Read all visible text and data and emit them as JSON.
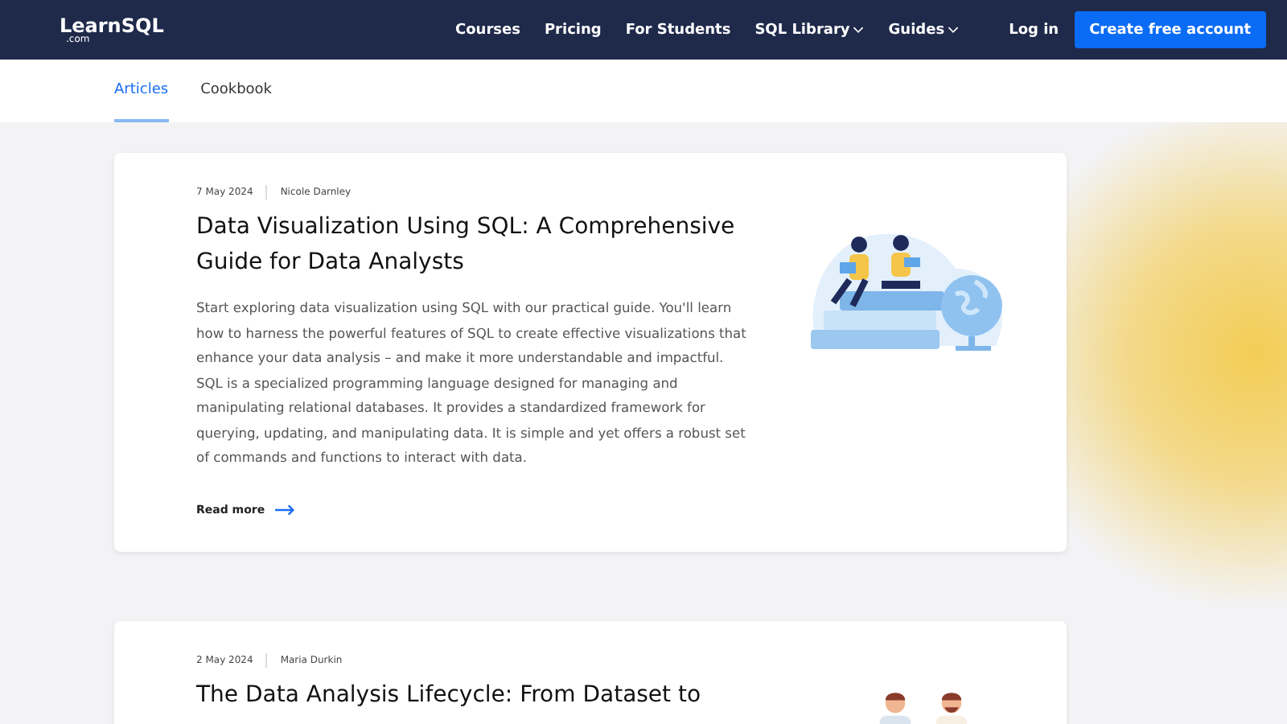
{
  "header": {
    "logo": {
      "name": "LearnSQL",
      "suffix": ".com"
    },
    "nav": [
      {
        "label": "Courses",
        "dropdown": false
      },
      {
        "label": "Pricing",
        "dropdown": false
      },
      {
        "label": "For Students",
        "dropdown": false
      },
      {
        "label": "SQL Library",
        "dropdown": true
      },
      {
        "label": "Guides",
        "dropdown": true
      }
    ],
    "login": "Log in",
    "cta": "Create free account"
  },
  "tabs": [
    {
      "label": "Articles",
      "selected": true
    },
    {
      "label": "Cookbook",
      "selected": false
    }
  ],
  "articles": [
    {
      "date": "7 May 2024",
      "author": "Nicole Darnley",
      "title": "Data Visualization Using SQL: A Comprehensive Guide for Data Analysts",
      "excerpt": "Start exploring data visualization using SQL with our practical guide. You'll learn how to harness the powerful features of SQL to create effective visualizations that enhance your data analysis – and make it more understandable and impactful. SQL is a specialized programming language designed for managing and manipulating relational databases. It provides a standardized framework for querying, updating, and manipulating data. It is simple and yet offers a robust set of commands and functions to interact with data.",
      "read_more": "Read more",
      "kind": "readers"
    },
    {
      "date": "2 May 2024",
      "author": "Maria Durkin",
      "title": "The Data Analysis Lifecycle: From Dataset to",
      "kind": "two-men"
    }
  ]
}
